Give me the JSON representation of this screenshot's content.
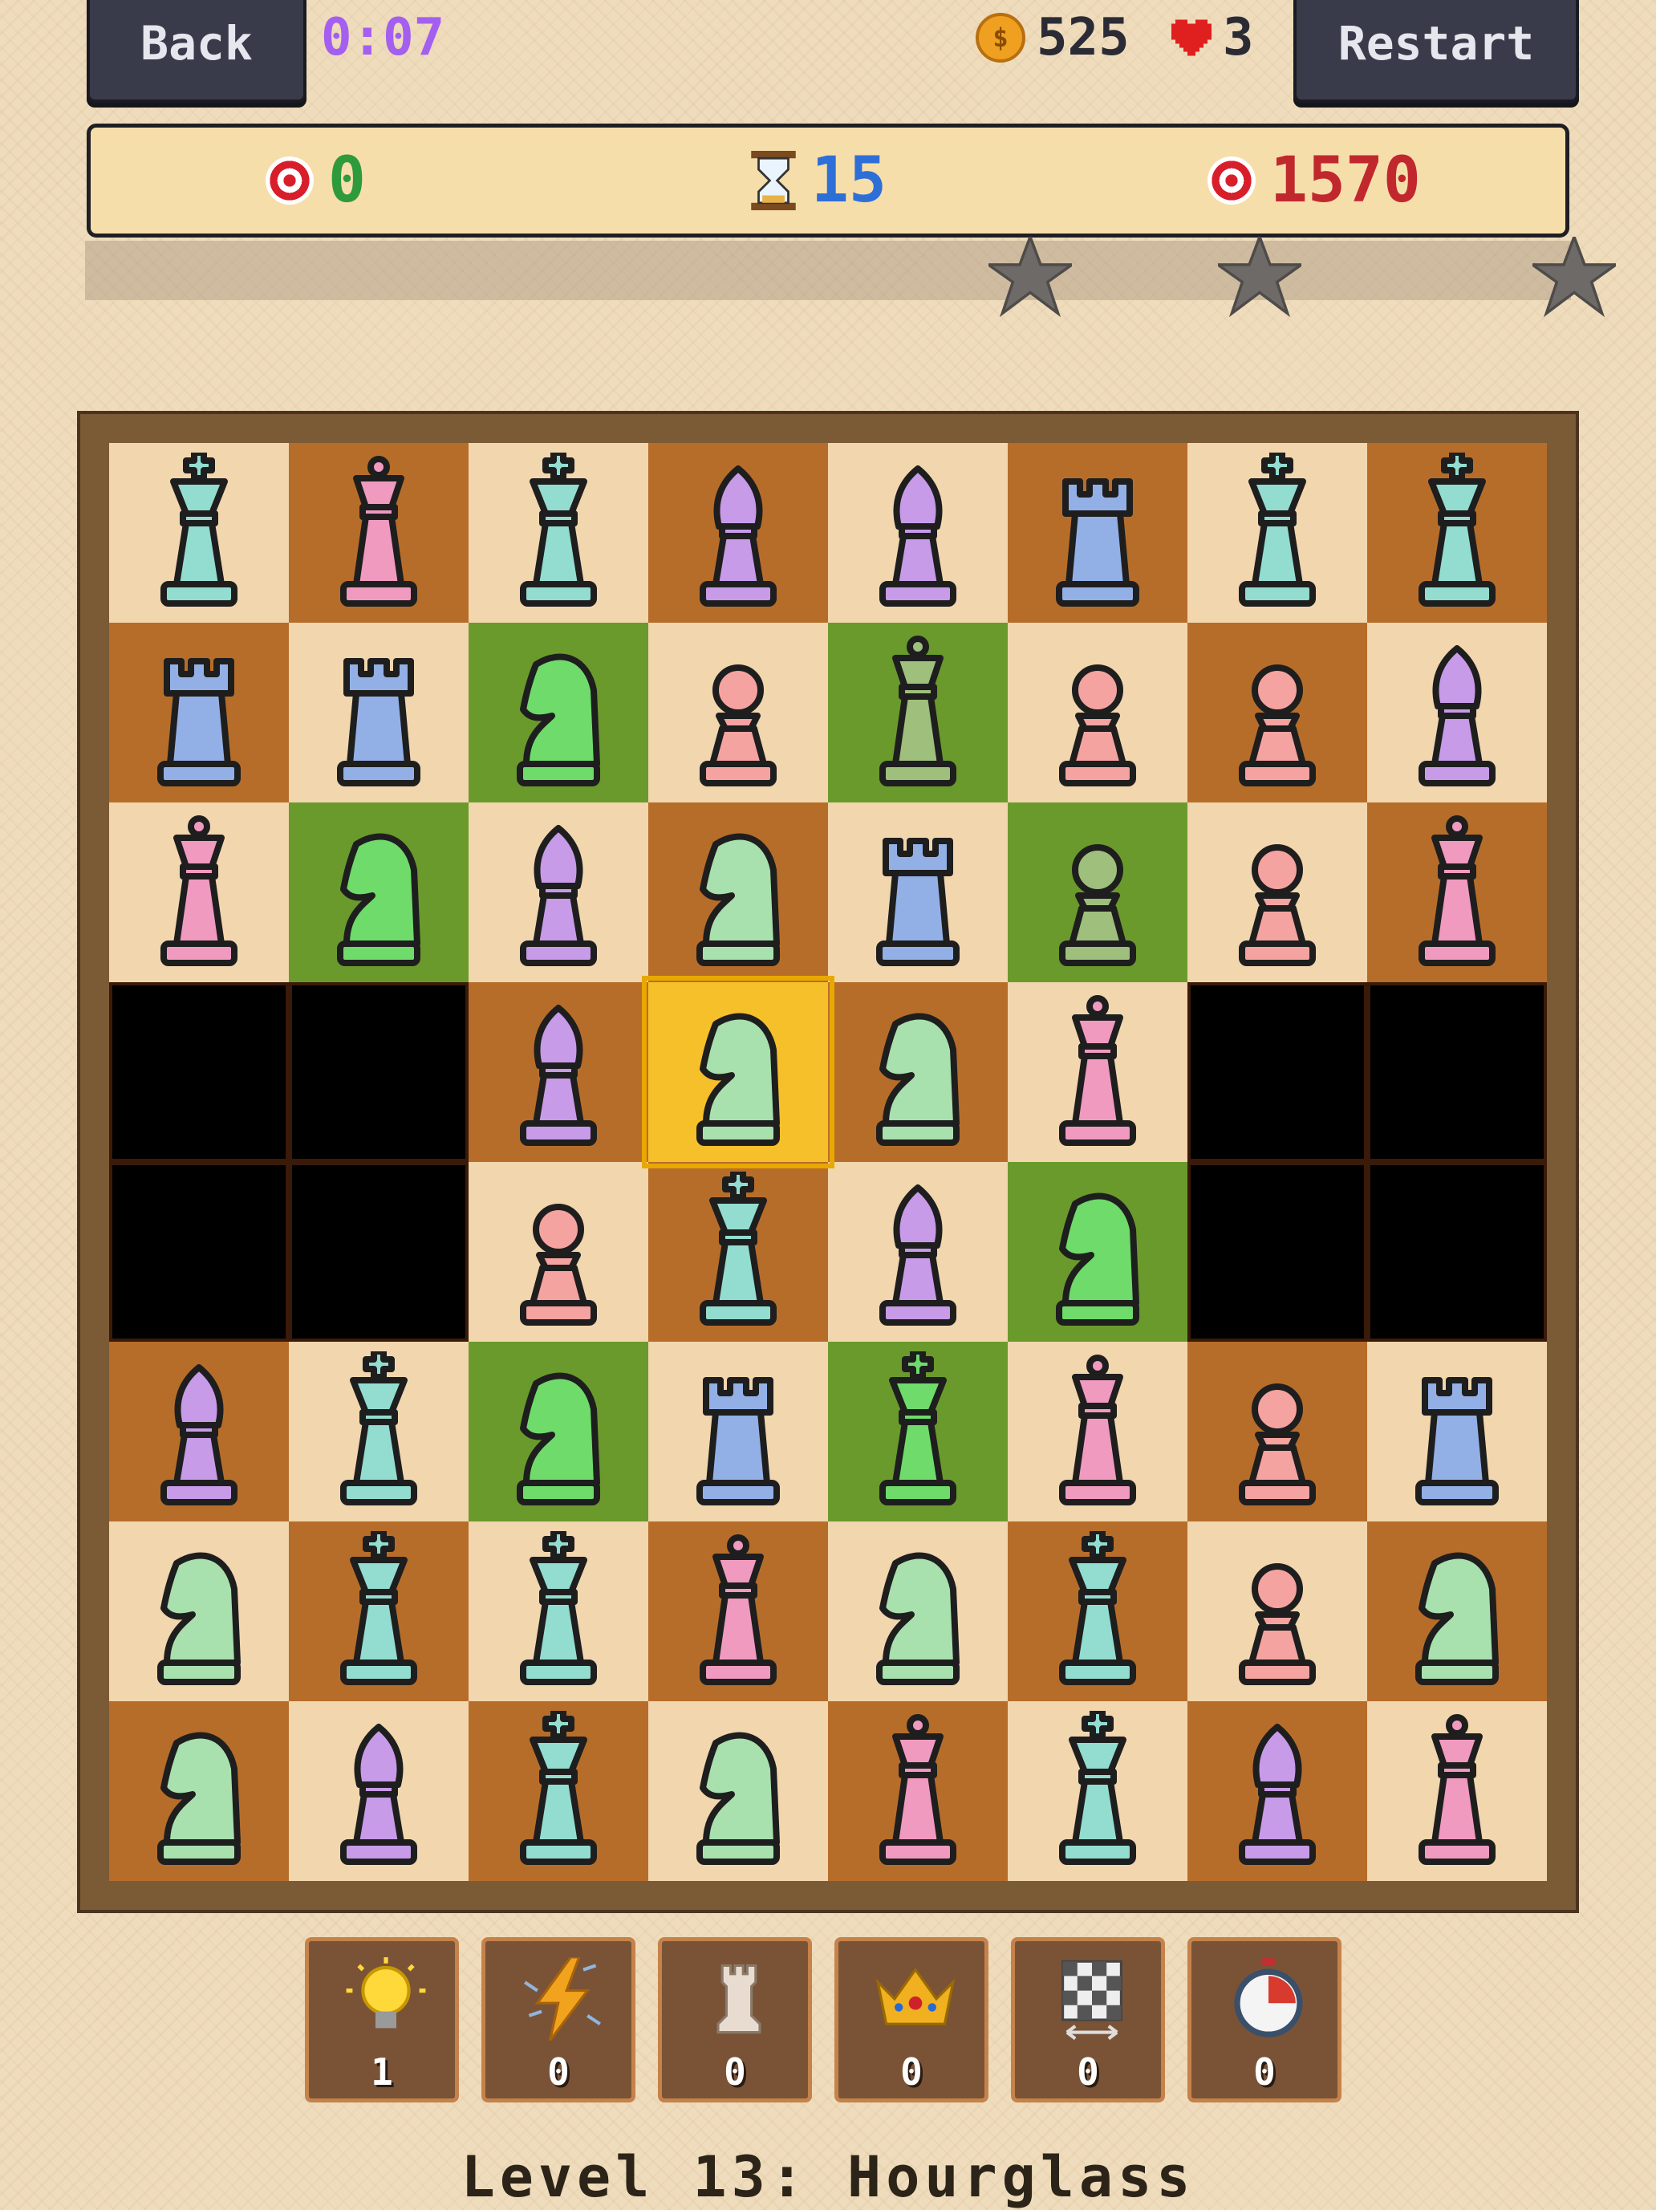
{
  "header": {
    "back_label": "Back",
    "restart_label": "Restart",
    "timer": "0:07",
    "coins": "525",
    "lives": "3"
  },
  "goals": {
    "score": "0",
    "moves": "15",
    "target_score": "1570"
  },
  "progress": {
    "fraction": 0.0,
    "stars": 3
  },
  "board": {
    "rows": 8,
    "cols": 8,
    "selected": [
      3,
      3
    ],
    "cells": [
      [
        {
          "t": "light",
          "p": "king",
          "c": "teal"
        },
        {
          "t": "dark",
          "p": "queen",
          "c": "pink"
        },
        {
          "t": "light",
          "p": "king",
          "c": "teal"
        },
        {
          "t": "dark",
          "p": "bishop",
          "c": "purple"
        },
        {
          "t": "light",
          "p": "bishop",
          "c": "purple"
        },
        {
          "t": "dark",
          "p": "rook",
          "c": "blue"
        },
        {
          "t": "light",
          "p": "king",
          "c": "teal"
        },
        {
          "t": "dark",
          "p": "king",
          "c": "teal"
        }
      ],
      [
        {
          "t": "dark",
          "p": "rook",
          "c": "blue"
        },
        {
          "t": "light",
          "p": "rook",
          "c": "blue"
        },
        {
          "t": "green",
          "p": "knight",
          "c": "green"
        },
        {
          "t": "light",
          "p": "pawn",
          "c": "salmon"
        },
        {
          "t": "green",
          "p": "queen",
          "c": "olive"
        },
        {
          "t": "light",
          "p": "pawn",
          "c": "salmon"
        },
        {
          "t": "dark",
          "p": "pawn",
          "c": "salmon"
        },
        {
          "t": "light",
          "p": "bishop",
          "c": "purple"
        }
      ],
      [
        {
          "t": "light",
          "p": "queen",
          "c": "pink"
        },
        {
          "t": "green",
          "p": "knight",
          "c": "green"
        },
        {
          "t": "light",
          "p": "bishop",
          "c": "purple"
        },
        {
          "t": "dark",
          "p": "knight",
          "c": "mint"
        },
        {
          "t": "light",
          "p": "rook",
          "c": "blue"
        },
        {
          "t": "green",
          "p": "pawn",
          "c": "olive"
        },
        {
          "t": "light",
          "p": "pawn",
          "c": "salmon"
        },
        {
          "t": "dark",
          "p": "queen",
          "c": "pink"
        }
      ],
      [
        {
          "t": "hole",
          "p": "",
          "c": ""
        },
        {
          "t": "hole",
          "p": "",
          "c": ""
        },
        {
          "t": "dark",
          "p": "bishop",
          "c": "purple"
        },
        {
          "t": "sel",
          "p": "knight",
          "c": "mint"
        },
        {
          "t": "dark",
          "p": "knight",
          "c": "mint"
        },
        {
          "t": "light",
          "p": "queen",
          "c": "pink"
        },
        {
          "t": "hole",
          "p": "",
          "c": ""
        },
        {
          "t": "hole",
          "p": "",
          "c": ""
        }
      ],
      [
        {
          "t": "hole",
          "p": "",
          "c": ""
        },
        {
          "t": "hole",
          "p": "",
          "c": ""
        },
        {
          "t": "light",
          "p": "pawn",
          "c": "salmon"
        },
        {
          "t": "dark",
          "p": "king",
          "c": "teal"
        },
        {
          "t": "light",
          "p": "bishop",
          "c": "purple"
        },
        {
          "t": "green",
          "p": "knight",
          "c": "green"
        },
        {
          "t": "hole",
          "p": "",
          "c": ""
        },
        {
          "t": "hole",
          "p": "",
          "c": ""
        }
      ],
      [
        {
          "t": "dark",
          "p": "bishop",
          "c": "purple"
        },
        {
          "t": "light",
          "p": "king",
          "c": "teal"
        },
        {
          "t": "green",
          "p": "knight",
          "c": "green"
        },
        {
          "t": "light",
          "p": "rook",
          "c": "blue"
        },
        {
          "t": "green",
          "p": "king",
          "c": "green"
        },
        {
          "t": "light",
          "p": "queen",
          "c": "pink"
        },
        {
          "t": "dark",
          "p": "pawn",
          "c": "salmon"
        },
        {
          "t": "light",
          "p": "rook",
          "c": "blue"
        }
      ],
      [
        {
          "t": "light",
          "p": "knight",
          "c": "mint"
        },
        {
          "t": "dark",
          "p": "king",
          "c": "teal"
        },
        {
          "t": "light",
          "p": "king",
          "c": "teal"
        },
        {
          "t": "dark",
          "p": "queen",
          "c": "pink"
        },
        {
          "t": "light",
          "p": "knight",
          "c": "mint"
        },
        {
          "t": "dark",
          "p": "king",
          "c": "teal"
        },
        {
          "t": "light",
          "p": "pawn",
          "c": "salmon"
        },
        {
          "t": "dark",
          "p": "knight",
          "c": "mint"
        }
      ],
      [
        {
          "t": "dark",
          "p": "knight",
          "c": "mint"
        },
        {
          "t": "light",
          "p": "bishop",
          "c": "purple"
        },
        {
          "t": "dark",
          "p": "king",
          "c": "teal"
        },
        {
          "t": "light",
          "p": "knight",
          "c": "mint"
        },
        {
          "t": "dark",
          "p": "queen",
          "c": "pink"
        },
        {
          "t": "light",
          "p": "king",
          "c": "teal"
        },
        {
          "t": "dark",
          "p": "bishop",
          "c": "purple"
        },
        {
          "t": "light",
          "p": "queen",
          "c": "pink"
        }
      ]
    ]
  },
  "colors": {
    "teal": "#93dcd0",
    "pink": "#f09ac0",
    "purple": "#c79be8",
    "blue": "#93b0e6",
    "green": "#6edb6a",
    "olive": "#9fbf7d",
    "salmon": "#f5a3a0",
    "mint": "#a8e0ae"
  },
  "boosters": [
    {
      "name": "hint-bulb-icon",
      "count": "1"
    },
    {
      "name": "lightning-icon",
      "count": "0"
    },
    {
      "name": "rook-icon",
      "count": "0"
    },
    {
      "name": "crown-icon",
      "count": "0"
    },
    {
      "name": "board-swap-icon",
      "count": "0"
    },
    {
      "name": "stopwatch-icon",
      "count": "0"
    }
  ],
  "level_title": "Level 13: Hourglass"
}
